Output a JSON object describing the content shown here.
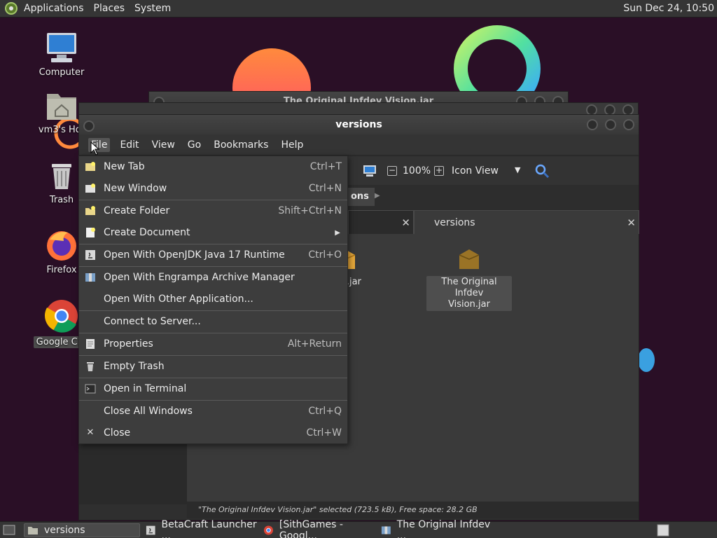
{
  "top_panel": {
    "items": [
      "Applications",
      "Places",
      "System"
    ],
    "clock": "Sun Dec 24, 10:50"
  },
  "desktop_icons": {
    "computer": "Computer",
    "home": "vm3's Hor",
    "trash": "Trash",
    "firefox": "Firefox",
    "chrome": "Google Chr"
  },
  "back_window": {
    "title": "The Original Infdev Vision.jar"
  },
  "file_manager": {
    "title": "versions",
    "menubar": [
      "File",
      "Edit",
      "View",
      "Go",
      "Bookmarks",
      "Help"
    ],
    "toolbar": {
      "zoom": "100%",
      "view_mode": "Icon View"
    },
    "pathbar_fragment": "ons",
    "tabs": [
      {
        "label": ""
      },
      {
        "label": "versions"
      }
    ],
    "files": [
      {
        "name": ".7.3.jar"
      },
      {
        "name": "The Original Infdev Vision.jar",
        "line1": "The Original Infdev",
        "line2": "Vision.jar"
      }
    ],
    "status": "\"The Original Infdev Vision.jar\" selected (723.5 kB), Free space: 28.2 GB"
  },
  "file_menu": {
    "items": [
      {
        "label": "New Tab",
        "accel": "Ctrl+T",
        "icon": "new-tab-icon"
      },
      {
        "label": "New Window",
        "accel": "Ctrl+N",
        "icon": "new-window-icon"
      },
      {
        "label": "Create Folder",
        "accel": "Shift+Ctrl+N",
        "icon": "folder-new-icon"
      },
      {
        "label": "Create Document",
        "accel": "",
        "icon": "document-new-icon"
      },
      {
        "label": "Open With OpenJDK Java 17 Runtime",
        "accel": "Ctrl+O",
        "icon": "java-icon"
      },
      {
        "label": "Open With Engrampa Archive Manager",
        "accel": "",
        "icon": "archive-icon"
      },
      {
        "label": "Open With Other Application...",
        "accel": "",
        "icon": ""
      },
      {
        "label": "Connect to Server...",
        "accel": "",
        "icon": ""
      },
      {
        "label": "Properties",
        "accel": "Alt+Return",
        "icon": "properties-icon"
      },
      {
        "label": "Empty Trash",
        "accel": "",
        "icon": "trash-icon"
      },
      {
        "label": "Open in Terminal",
        "accel": "",
        "icon": "terminal-icon"
      },
      {
        "label": "Close All Windows",
        "accel": "Ctrl+Q",
        "icon": ""
      },
      {
        "label": "Close",
        "accel": "Ctrl+W",
        "icon": "close-icon"
      }
    ]
  },
  "taskbar": {
    "tasks": [
      "versions",
      "BetaCraft Launcher ...",
      "[SithGames - Googl...",
      "The Original Infdev ..."
    ]
  },
  "colors": {
    "desktop_bg": "#2a0f26",
    "panel": "#353535",
    "menu_bg": "#3d3d3d"
  }
}
